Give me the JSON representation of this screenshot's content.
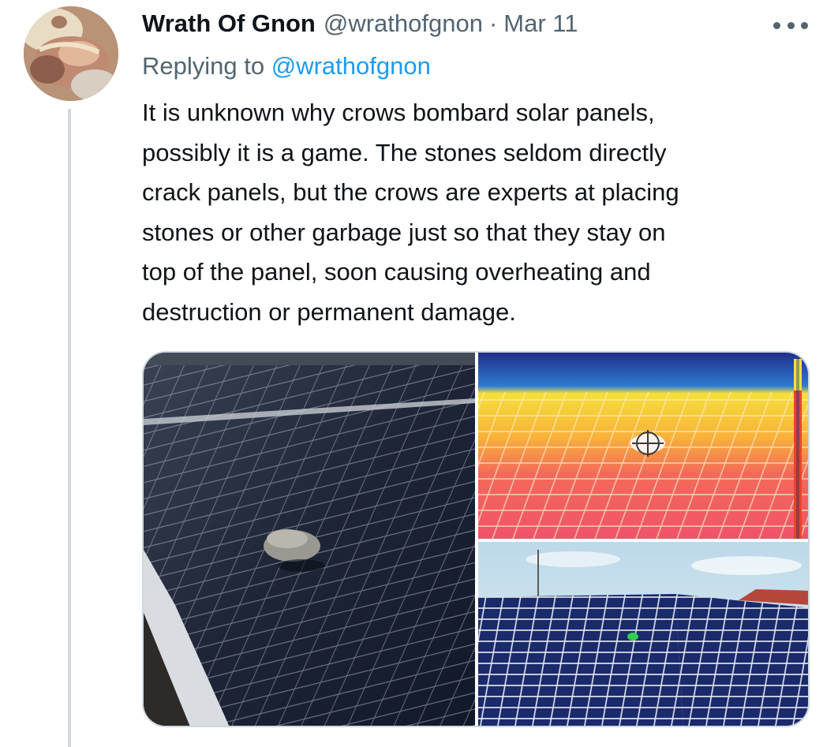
{
  "author": {
    "name": "Wrath Of Gnon",
    "handle": "@wrathofgnon",
    "separator": "·",
    "date": "Mar 11"
  },
  "reply": {
    "prefix": "Replying to",
    "mention": "@wrathofgnon"
  },
  "tweet": {
    "lines": [
      "It is unknown why crows bombard solar panels,",
      "possibly it is a game. The stones seldom directly",
      "crack panels, but the crows are experts at placing",
      "stones or other garbage just so that they stay on",
      "top of the panel, soon causing overheating and",
      "destruction or permanent damage."
    ]
  },
  "actions": {
    "more_icon": "more-horizontal-icon"
  },
  "colors": {
    "text": "#0f1419",
    "secondary": "#536471",
    "link": "#1d9bf0",
    "border": "#cfd9de"
  }
}
